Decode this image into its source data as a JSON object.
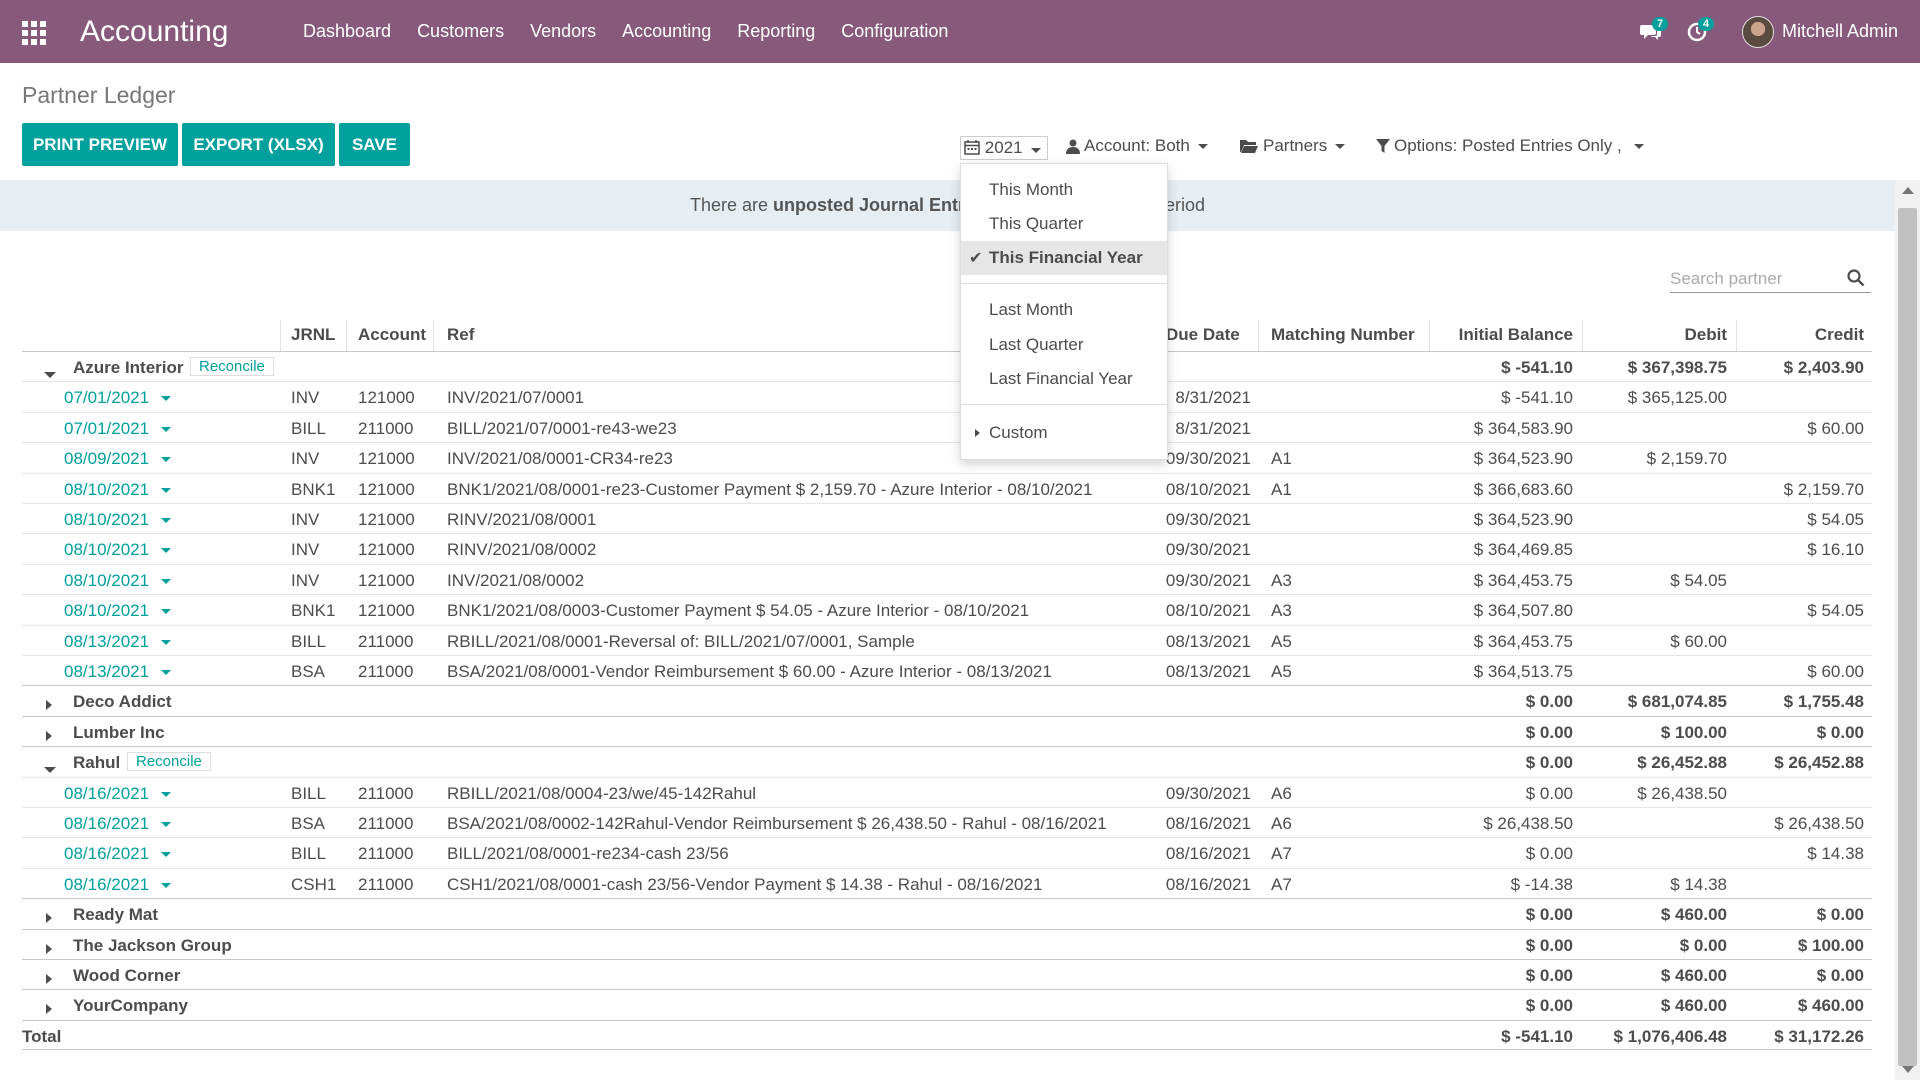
{
  "navbar": {
    "app_title": "Accounting",
    "menu": [
      "Dashboard",
      "Customers",
      "Vendors",
      "Accounting",
      "Reporting",
      "Configuration"
    ],
    "messages_badge": "7",
    "activities_badge": "4",
    "user_name": "Mitchell Admin",
    "color": "#875a7b"
  },
  "page": {
    "title": "Partner Ledger",
    "buttons": {
      "print_preview": "PRINT PREVIEW",
      "export": "EXPORT (XLSX)",
      "save": "SAVE"
    },
    "filters": {
      "date": "2021",
      "account": "Account: Both",
      "partners": "Partners",
      "options": "Options: Posted Entries Only ,"
    },
    "accent_color": "#00a09d"
  },
  "banner": {
    "prefix": "There are ",
    "bold": "unposted Journal Entrie",
    "suffix": "eriod"
  },
  "search": {
    "placeholder": "Search partner"
  },
  "date_dropdown": {
    "items": [
      "This Month",
      "This Quarter",
      "This Financial Year",
      "Last Month",
      "Last Quarter",
      "Last Financial Year",
      "Custom"
    ],
    "selected": "This Financial Year"
  },
  "table": {
    "headers": {
      "jrnl": "JRNL",
      "account": "Account",
      "ref": "Ref",
      "due_date": "Due Date",
      "matching": "Matching Number",
      "initial_balance": "Initial Balance",
      "debit": "Debit",
      "credit": "Credit"
    },
    "reconcile_label": "Reconcile",
    "groups": [
      {
        "partner": "Azure Interior",
        "expanded": true,
        "reconcile": true,
        "initial_balance": "$ -541.10",
        "debit": "$ 367,398.75",
        "credit": "$ 2,403.90",
        "lines": [
          {
            "date": "07/01/2021",
            "jrnl": "INV",
            "account": "121000",
            "ref": "INV/2021/07/0001",
            "due": "8/31/2021",
            "match": "",
            "initial": "$ -541.10",
            "debit": "$ 365,125.00",
            "credit": ""
          },
          {
            "date": "07/01/2021",
            "jrnl": "BILL",
            "account": "211000",
            "ref": "BILL/2021/07/0001-re43-we23",
            "due": "8/31/2021",
            "match": "",
            "initial": "$ 364,583.90",
            "debit": "",
            "credit": "$ 60.00"
          },
          {
            "date": "08/09/2021",
            "jrnl": "INV",
            "account": "121000",
            "ref": "INV/2021/08/0001-CR34-re23",
            "due": "09/30/2021",
            "match": "A1",
            "initial": "$ 364,523.90",
            "debit": "$ 2,159.70",
            "credit": ""
          },
          {
            "date": "08/10/2021",
            "jrnl": "BNK1",
            "account": "121000",
            "ref": "BNK1/2021/08/0001-re23-Customer Payment $ 2,159.70 - Azure Interior - 08/10/2021",
            "due": "08/10/2021",
            "match": "A1",
            "initial": "$ 366,683.60",
            "debit": "",
            "credit": "$ 2,159.70"
          },
          {
            "date": "08/10/2021",
            "jrnl": "INV",
            "account": "121000",
            "ref": "RINV/2021/08/0001",
            "due": "09/30/2021",
            "match": "",
            "initial": "$ 364,523.90",
            "debit": "",
            "credit": "$ 54.05"
          },
          {
            "date": "08/10/2021",
            "jrnl": "INV",
            "account": "121000",
            "ref": "RINV/2021/08/0002",
            "due": "09/30/2021",
            "match": "",
            "initial": "$ 364,469.85",
            "debit": "",
            "credit": "$ 16.10"
          },
          {
            "date": "08/10/2021",
            "jrnl": "INV",
            "account": "121000",
            "ref": "INV/2021/08/0002",
            "due": "09/30/2021",
            "match": "A3",
            "initial": "$ 364,453.75",
            "debit": "$ 54.05",
            "credit": ""
          },
          {
            "date": "08/10/2021",
            "jrnl": "BNK1",
            "account": "121000",
            "ref": "BNK1/2021/08/0003-Customer Payment $ 54.05 - Azure Interior - 08/10/2021",
            "due": "08/10/2021",
            "match": "A3",
            "initial": "$ 364,507.80",
            "debit": "",
            "credit": "$ 54.05"
          },
          {
            "date": "08/13/2021",
            "jrnl": "BILL",
            "account": "211000",
            "ref": "RBILL/2021/08/0001-Reversal of: BILL/2021/07/0001, Sample",
            "due": "08/13/2021",
            "match": "A5",
            "initial": "$ 364,453.75",
            "debit": "$ 60.00",
            "credit": ""
          },
          {
            "date": "08/13/2021",
            "jrnl": "BSA",
            "account": "211000",
            "ref": "BSA/2021/08/0001-Vendor Reimbursement $ 60.00 - Azure Interior - 08/13/2021",
            "due": "08/13/2021",
            "match": "A5",
            "initial": "$ 364,513.75",
            "debit": "",
            "credit": "$ 60.00"
          }
        ]
      },
      {
        "partner": "Deco Addict",
        "expanded": false,
        "reconcile": false,
        "initial_balance": "$ 0.00",
        "debit": "$ 681,074.85",
        "credit": "$ 1,755.48",
        "lines": []
      },
      {
        "partner": "Lumber Inc",
        "expanded": false,
        "reconcile": false,
        "initial_balance": "$ 0.00",
        "debit": "$ 100.00",
        "credit": "$ 0.00",
        "lines": []
      },
      {
        "partner": "Rahul",
        "expanded": true,
        "reconcile": true,
        "initial_balance": "$ 0.00",
        "debit": "$ 26,452.88",
        "credit": "$ 26,452.88",
        "lines": [
          {
            "date": "08/16/2021",
            "jrnl": "BILL",
            "account": "211000",
            "ref": "RBILL/2021/08/0004-23/we/45-142Rahul",
            "due": "09/30/2021",
            "match": "A6",
            "initial": "$ 0.00",
            "debit": "$ 26,438.50",
            "credit": ""
          },
          {
            "date": "08/16/2021",
            "jrnl": "BSA",
            "account": "211000",
            "ref": "BSA/2021/08/0002-142Rahul-Vendor Reimbursement $ 26,438.50 - Rahul - 08/16/2021",
            "due": "08/16/2021",
            "match": "A6",
            "initial": "$ 26,438.50",
            "debit": "",
            "credit": "$ 26,438.50"
          },
          {
            "date": "08/16/2021",
            "jrnl": "BILL",
            "account": "211000",
            "ref": "BILL/2021/08/0001-re234-cash 23/56",
            "due": "08/16/2021",
            "match": "A7",
            "initial": "$ 0.00",
            "debit": "",
            "credit": "$ 14.38"
          },
          {
            "date": "08/16/2021",
            "jrnl": "CSH1",
            "account": "211000",
            "ref": "CSH1/2021/08/0001-cash 23/56-Vendor Payment $ 14.38 - Rahul - 08/16/2021",
            "due": "08/16/2021",
            "match": "A7",
            "initial": "$ -14.38",
            "debit": "$ 14.38",
            "credit": ""
          }
        ]
      },
      {
        "partner": "Ready Mat",
        "expanded": false,
        "reconcile": false,
        "initial_balance": "$ 0.00",
        "debit": "$ 460.00",
        "credit": "$ 0.00",
        "lines": []
      },
      {
        "partner": "The Jackson Group",
        "expanded": false,
        "reconcile": false,
        "initial_balance": "$ 0.00",
        "debit": "$ 0.00",
        "credit": "$ 100.00",
        "lines": []
      },
      {
        "partner": "Wood Corner",
        "expanded": false,
        "reconcile": false,
        "initial_balance": "$ 0.00",
        "debit": "$ 460.00",
        "credit": "$ 0.00",
        "lines": []
      },
      {
        "partner": "YourCompany",
        "expanded": false,
        "reconcile": false,
        "initial_balance": "$ 0.00",
        "debit": "$ 460.00",
        "credit": "$ 460.00",
        "lines": []
      }
    ],
    "total": {
      "label": "Total",
      "initial_balance": "$ -541.10",
      "debit": "$ 1,076,406.48",
      "credit": "$ 31,172.26"
    }
  }
}
